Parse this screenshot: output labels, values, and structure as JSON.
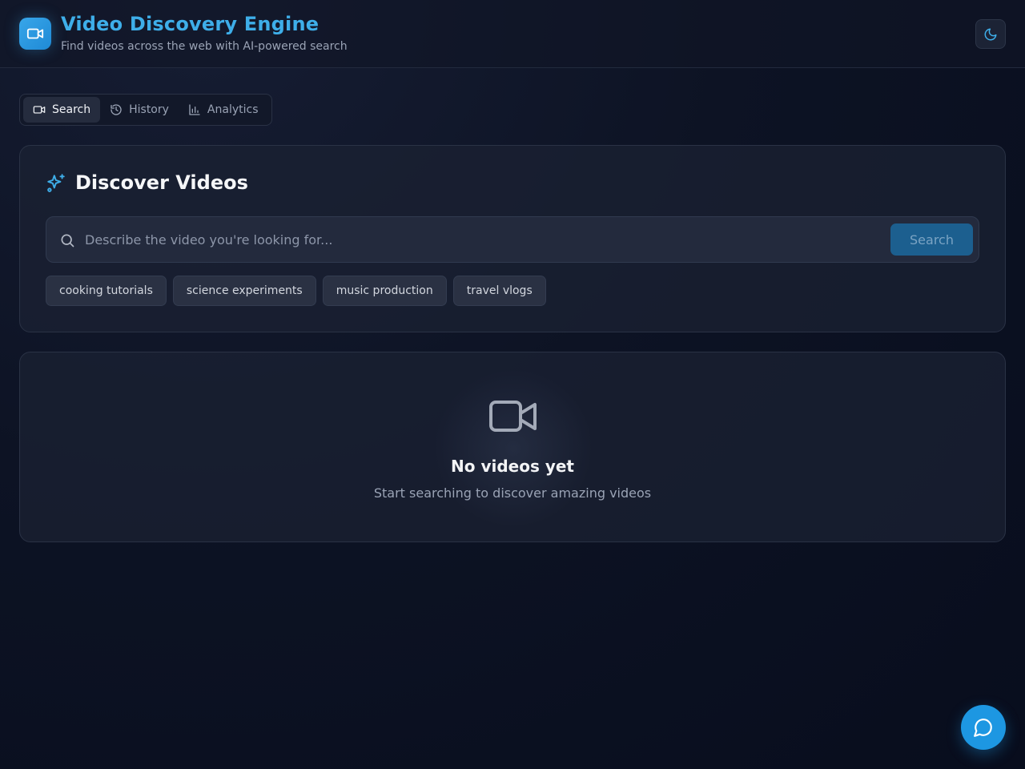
{
  "header": {
    "title": "Video Discovery Engine",
    "subtitle": "Find videos across the web with AI-powered search",
    "logo_icon": "video-camera-icon",
    "theme_toggle_icon": "moon-icon"
  },
  "tabs": [
    {
      "label": "Search",
      "icon": "video-camera-icon",
      "active": true
    },
    {
      "label": "History",
      "icon": "history-icon",
      "active": false
    },
    {
      "label": "Analytics",
      "icon": "bar-chart-icon",
      "active": false
    }
  ],
  "search_card": {
    "title": "Discover Videos",
    "title_icon": "sparkles-icon",
    "input_value": "",
    "placeholder": "Describe the video you're looking for...",
    "button_label": "Search",
    "suggestions": [
      "cooking tutorials",
      "science experiments",
      "music production",
      "travel vlogs"
    ]
  },
  "empty_state": {
    "icon": "video-camera-icon",
    "title": "No videos yet",
    "subtitle": "Start searching to discover amazing videos"
  },
  "chat_fab": {
    "icon": "chat-bubble-icon"
  },
  "colors": {
    "accent": "#3eaee9",
    "button": "#1c5f8f",
    "fab": "#1d97e2",
    "background": "#0d1324"
  }
}
